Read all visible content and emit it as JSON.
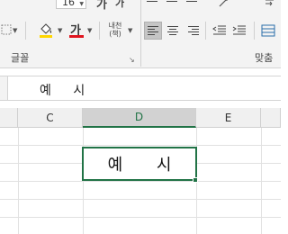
{
  "ribbon": {
    "font_size": "16",
    "grow_font": "가",
    "shrink_font": "가",
    "font_color_glyph": "가",
    "phonetic_label": "내천",
    "phonetic_sub": "(책)",
    "font_group_label": "글꼴",
    "align_group_label": "맞춤",
    "fill_color": "#ffd600",
    "font_color": "#e0141e"
  },
  "formula_bar": {
    "value": "예 시"
  },
  "columns": [
    {
      "label": "C",
      "selected": false
    },
    {
      "label": "D",
      "selected": true
    },
    {
      "label": "E",
      "selected": false
    }
  ],
  "active_cell": {
    "value": "예 시"
  },
  "accent_color": "#217346"
}
